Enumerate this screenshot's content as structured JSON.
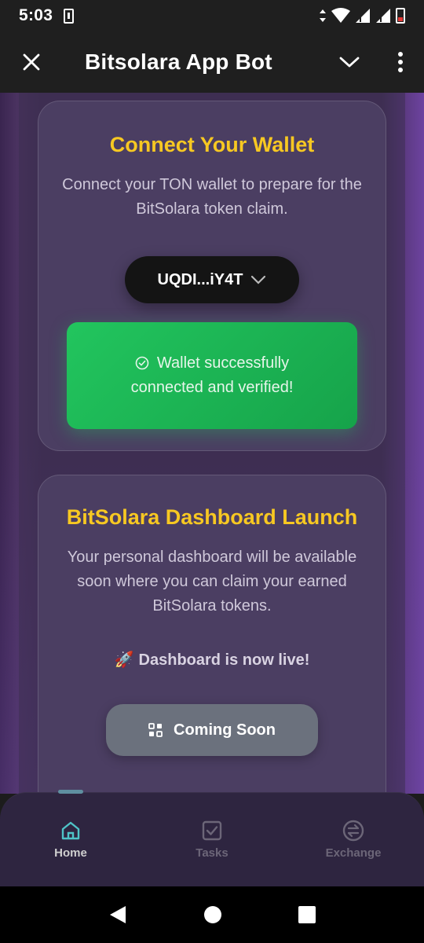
{
  "status_bar": {
    "time": "5:03"
  },
  "app_bar": {
    "title": "Bitsolara App Bot"
  },
  "wallet_card": {
    "title": "Connect Your Wallet",
    "description": "Connect your TON wallet to prepare for the BitSolara token claim.",
    "wallet_address": "UQDI...iY4T",
    "success_message": "Wallet successfully connected and verified!"
  },
  "dashboard_card": {
    "title": "BitSolara Dashboard Launch",
    "description": "Your personal dashboard will be available soon where you can claim your earned BitSolara tokens.",
    "live_emoji": "🚀",
    "live_text": "Dashboard is now live!",
    "button_label": "Coming Soon"
  },
  "bottom_nav": {
    "items": [
      {
        "label": "Home",
        "icon": "home-icon",
        "active": true
      },
      {
        "label": "Tasks",
        "icon": "tasks-icon",
        "active": false
      },
      {
        "label": "Exchange",
        "icon": "exchange-icon",
        "active": false
      }
    ]
  },
  "colors": {
    "accent_yellow": "#f7c822",
    "success_green": "#22c55e",
    "nav_active": "#4fc3c7",
    "background_purple": "#3e2e52"
  }
}
